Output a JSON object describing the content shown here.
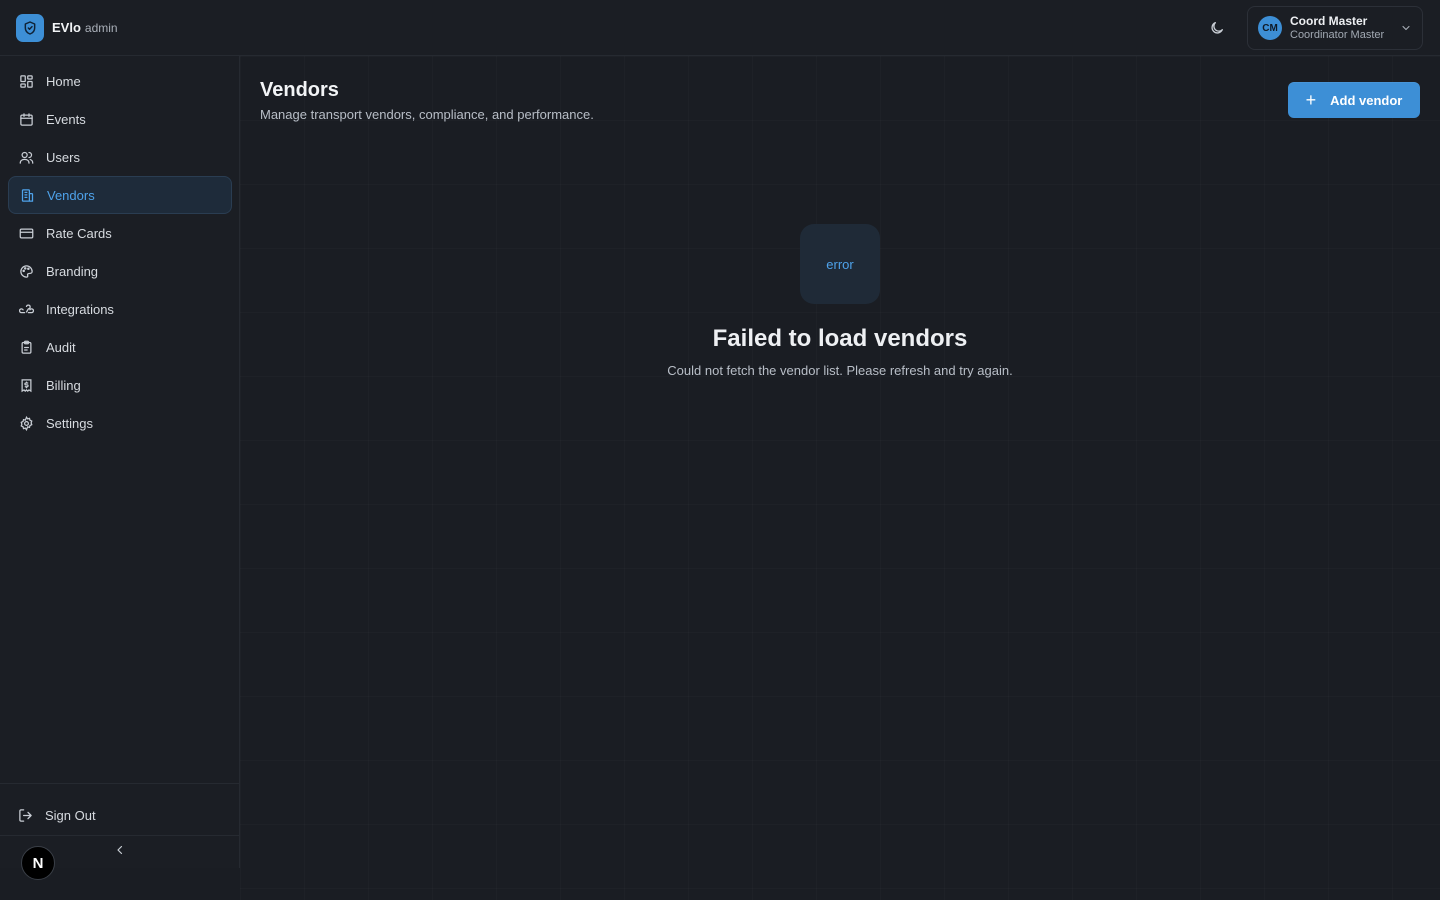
{
  "brand": {
    "name": "EVlo",
    "sub": "admin"
  },
  "user": {
    "initials": "CM",
    "name": "Coord Master",
    "role": "Coordinator Master"
  },
  "sidebar": {
    "items": [
      {
        "label": "Home",
        "icon": "grid-icon"
      },
      {
        "label": "Events",
        "icon": "calendar-icon"
      },
      {
        "label": "Users",
        "icon": "users-icon"
      },
      {
        "label": "Vendors",
        "icon": "building-icon",
        "active": true
      },
      {
        "label": "Rate Cards",
        "icon": "card-icon"
      },
      {
        "label": "Branding",
        "icon": "palette-icon"
      },
      {
        "label": "Integrations",
        "icon": "webhook-icon"
      },
      {
        "label": "Audit",
        "icon": "clipboard-icon"
      },
      {
        "label": "Billing",
        "icon": "receipt-icon"
      },
      {
        "label": "Settings",
        "icon": "gear-icon"
      }
    ],
    "signout_label": "Sign Out",
    "badge_letter": "N"
  },
  "page": {
    "title": "Vendors",
    "subtitle": "Manage transport vendors, compliance, and performance.",
    "add_button_label": "Add vendor"
  },
  "error": {
    "icon_text": "error",
    "title": "Failed to load vendors",
    "description": "Could not fetch the vendor list. Please refresh and try again."
  },
  "colors": {
    "accent": "#3d8fd6",
    "background": "#1a1d23",
    "active_text": "#4ea2ea"
  }
}
